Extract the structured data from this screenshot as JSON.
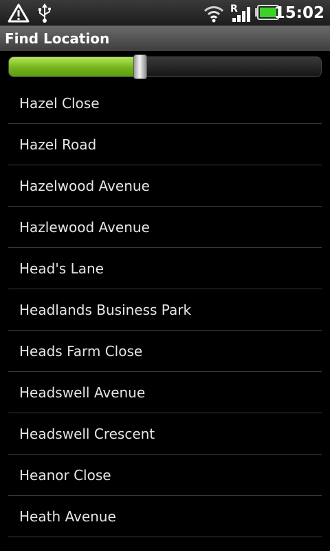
{
  "status_bar": {
    "time": "15:02",
    "icons": [
      "warning-icon",
      "usb-icon",
      "wifi-icon",
      "roaming-icon",
      "signal-icon",
      "battery-icon"
    ],
    "roaming_letter": "R",
    "battery_color": "#3cd22a"
  },
  "header": {
    "title": "Find Location"
  },
  "slider": {
    "value_percent": 42,
    "fill_color": "#7cc21f"
  },
  "list": {
    "items": [
      "Hazel Close",
      "Hazel Road",
      "Hazelwood Avenue",
      "Hazlewood Avenue",
      "Head's Lane",
      "Headlands Business Park",
      "Heads Farm Close",
      "Headswell Avenue",
      "Headswell Crescent",
      "Heanor Close",
      "Heath Avenue"
    ]
  }
}
